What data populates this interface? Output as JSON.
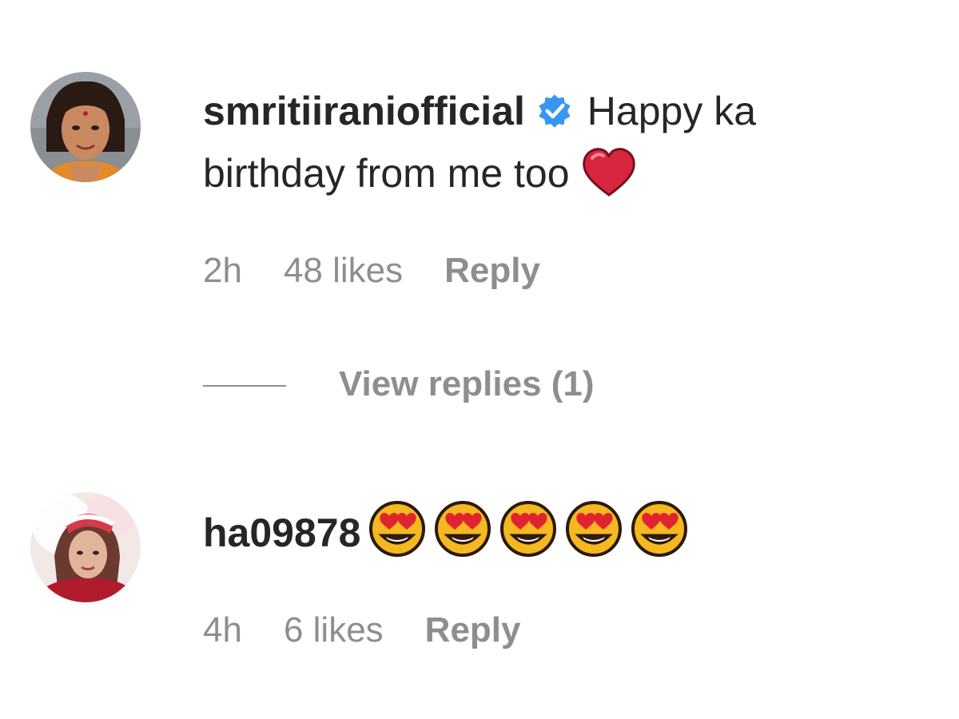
{
  "comments": [
    {
      "username": "smritiiraniofficial",
      "verified": true,
      "text_line1": "Happy ka",
      "text_line2": "birthday from me too",
      "emoji": "red-heart",
      "time": "2h",
      "likes": "48 likes",
      "reply_label": "Reply",
      "view_replies": "View replies (1)"
    },
    {
      "username": "ha09878",
      "verified": false,
      "emoji": "heart-eyes",
      "emoji_count": 5,
      "time": "4h",
      "likes": "6 likes",
      "reply_label": "Reply"
    }
  ],
  "colors": {
    "text": "#262626",
    "secondary": "#8e8e8e",
    "verified": "#3897f0",
    "heart": "#d7263d"
  }
}
